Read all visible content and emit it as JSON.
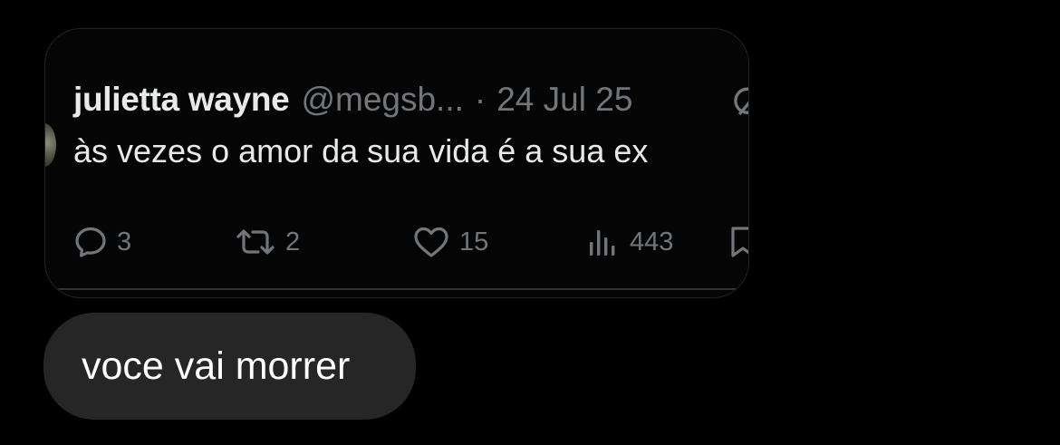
{
  "tweet": {
    "author_name": "julietta wayne",
    "handle": "@megsb...",
    "separator": "·",
    "date": "24 Jul 25",
    "text": "às vezes o amor da sua vida é a sua ex",
    "actions": {
      "replies": "3",
      "reposts": "2",
      "likes": "15",
      "views": "443"
    },
    "icons": [
      "reply-icon",
      "repost-icon",
      "like-icon",
      "views-icon",
      "bookmark-icon",
      "grok-icon"
    ]
  },
  "message": {
    "text": "voce vai morrer"
  },
  "colors": {
    "background": "#000000",
    "card_border": "#1f2327",
    "muted": "#71767b",
    "primary_text": "#e7e9ea",
    "bubble": "#262626"
  }
}
